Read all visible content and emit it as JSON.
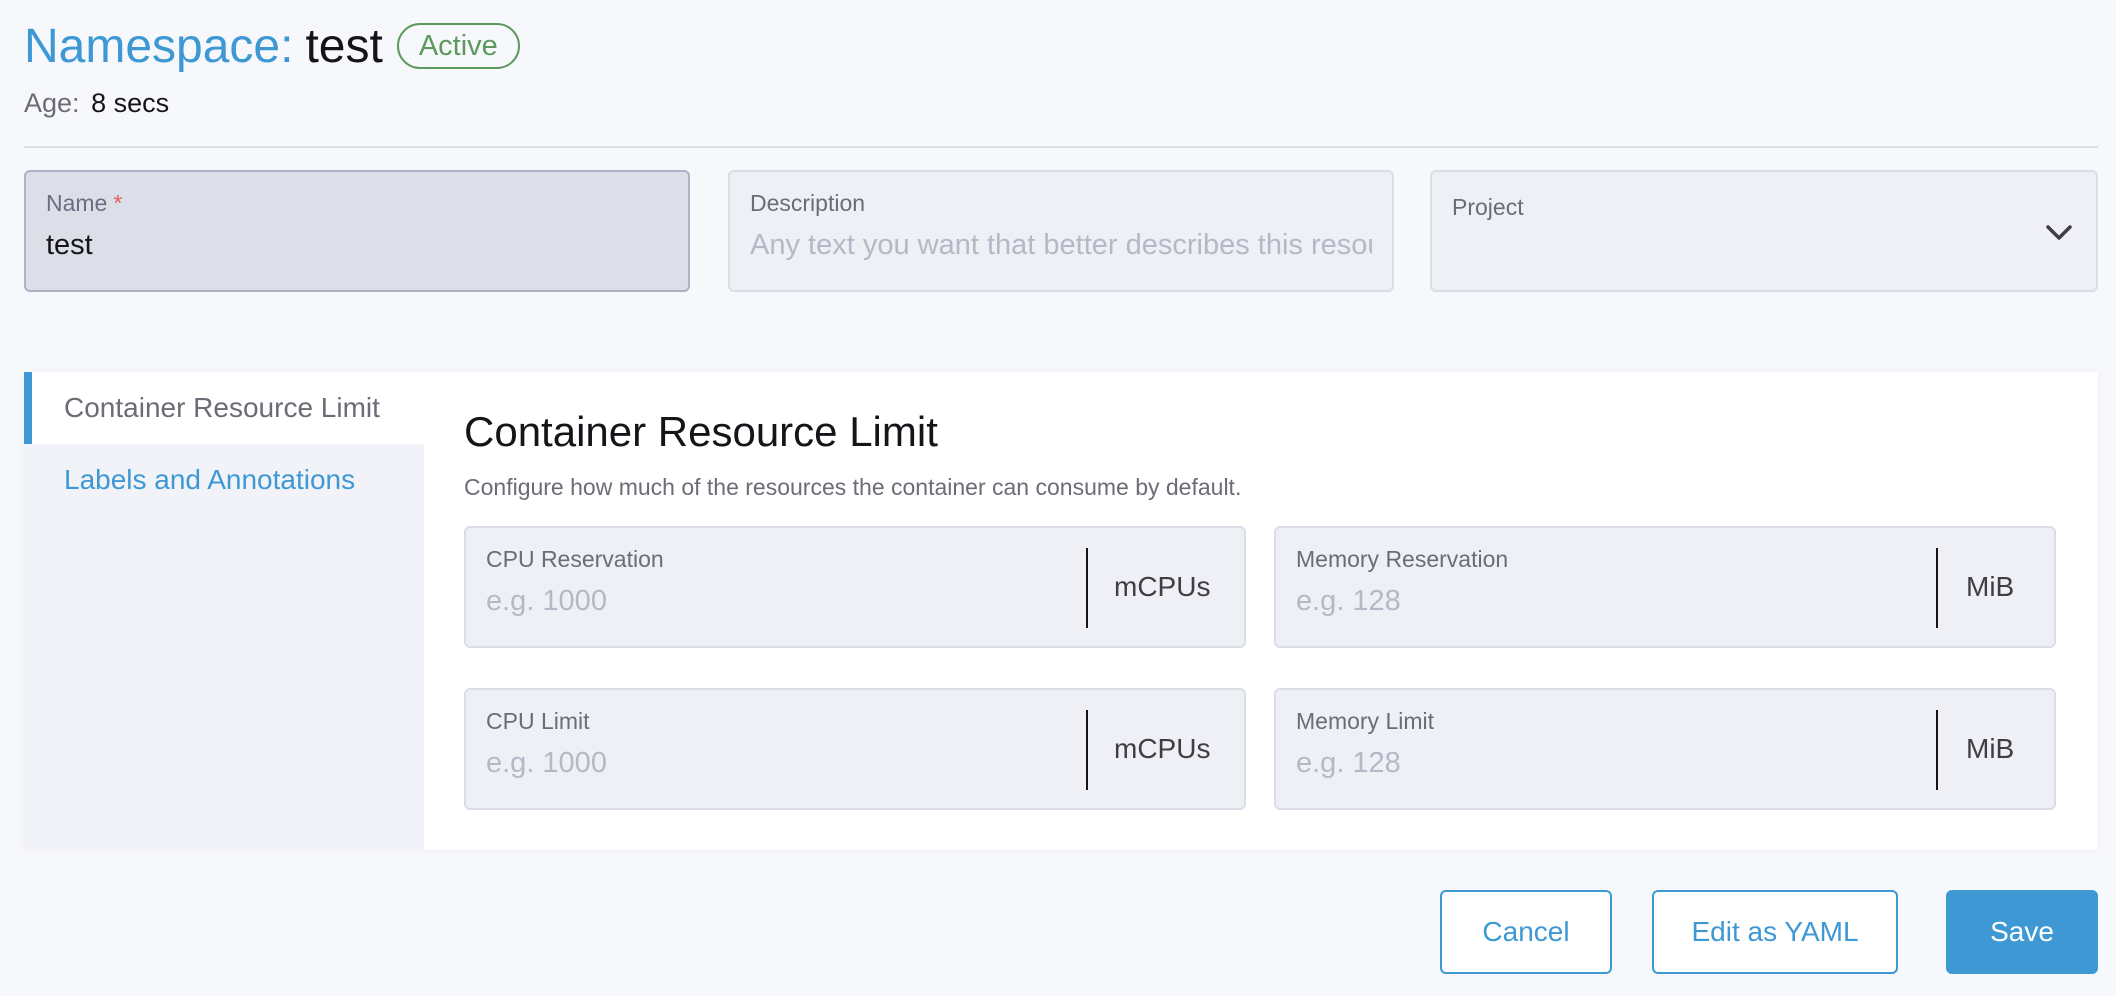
{
  "header": {
    "title_prefix": "Namespace:",
    "title_name": "test",
    "status_badge": "Active",
    "age_label": "Age:",
    "age_value": "8 secs"
  },
  "form": {
    "name": {
      "label": "Name",
      "required_mark": "*",
      "value": "test"
    },
    "description": {
      "label": "Description",
      "placeholder": "Any text you want that better describes this resou"
    },
    "project": {
      "label": "Project",
      "value": ""
    }
  },
  "tabs": [
    {
      "label": "Container Resource Limit",
      "selected": true
    },
    {
      "label": "Labels and Annotations",
      "selected": false
    }
  ],
  "section": {
    "title": "Container Resource Limit",
    "description": "Configure how much of the resources the container can consume by default.",
    "fields": {
      "cpu_reservation": {
        "label": "CPU Reservation",
        "placeholder": "e.g. 1000",
        "unit": "mCPUs"
      },
      "memory_reservation": {
        "label": "Memory Reservation",
        "placeholder": "e.g. 128",
        "unit": "MiB"
      },
      "cpu_limit": {
        "label": "CPU Limit",
        "placeholder": "e.g. 1000",
        "unit": "mCPUs"
      },
      "memory_limit": {
        "label": "Memory Limit",
        "placeholder": "e.g. 128",
        "unit": "MiB"
      }
    }
  },
  "footer": {
    "cancel": "Cancel",
    "edit_yaml": "Edit as YAML",
    "save": "Save"
  },
  "colors": {
    "accent": "#3d98d3",
    "active_badge": "#5d995d",
    "required": "#e2605e"
  },
  "icons": {
    "project_dropdown": "chevron-down-icon"
  }
}
